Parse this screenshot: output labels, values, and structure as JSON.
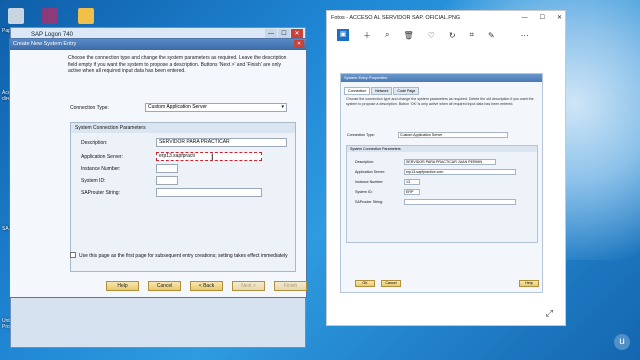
{
  "desktop": {
    "icons": [
      {
        "name": "papelera-icon",
        "label": "Papelera de...",
        "color": "#c8d4e0"
      },
      {
        "name": "winrar-icon",
        "label": "",
        "color": "#8b3a7a"
      },
      {
        "name": "folder-icon",
        "label": "",
        "color": "#f0c048"
      }
    ],
    "left_labels": [
      "Papelera de...",
      "Acces... directo",
      "SAP",
      "Untitled Project"
    ]
  },
  "logon": {
    "title": "SAP Logon 740"
  },
  "dialog": {
    "title": "Create New System Entry",
    "description": "Choose the connection type and change the system parameters as required. Leave the description field empty if you want the system to propose a description. Buttons 'Next >' and 'Finish' are only active when all required input data has been entered.",
    "connection_type_label": "Connection Type:",
    "connection_type_value": "Custom Application Server",
    "group_title": "System Connection Parameters",
    "fields": [
      {
        "label": "Description:",
        "value": ""
      },
      {
        "label": "Application Server:",
        "value": "erp13.sapfpracti"
      },
      {
        "label": "Instance Number:",
        "value": ""
      },
      {
        "label": "System ID:",
        "value": ""
      },
      {
        "label": "SAProuter String:",
        "value": ""
      }
    ],
    "description_value": "SERVIDOR PARA PRACTICAR",
    "checkbox_label": "Use this page as the first page for subsequent entry creations; setting takes effect immediately",
    "buttons": {
      "help": "Help",
      "cancel": "Cancel",
      "back": "< Back",
      "next": "Next >",
      "finish": "Finish"
    }
  },
  "fotos": {
    "title": "Fotos - ACCESO AL SERVIDOR SAP. OFICIAL.PNG",
    "controls": {
      "min": "—",
      "max": "☐",
      "close": "✕"
    },
    "toolbar": [
      "＋",
      "⌕",
      "🗑",
      "♡",
      "↻",
      "⌗",
      "✎"
    ],
    "more": "⋯",
    "screenshot": {
      "title": "System Entry Properties",
      "tabs": [
        "Connection",
        "Network",
        "Code Page"
      ],
      "description": "Choose the connection type and change the system parameters as required. Delete the old description if you want the system to propose a description. Button 'OK' is only active when all required input data has been entered.",
      "connection_type_label": "Connection Type:",
      "connection_type_value": "Custom Application Server",
      "group_title": "System Connection Parameters",
      "fields": [
        {
          "label": "Description:",
          "value": "SERVIDOR PARA PRACTICAR JUAN PERMIN"
        },
        {
          "label": "Application Server:",
          "value": "erp13.sapfpractice.com"
        },
        {
          "label": "Instance Number:",
          "value": "13"
        },
        {
          "label": "System ID:",
          "value": "ERP"
        },
        {
          "label": "SAProuter String:",
          "value": ""
        }
      ],
      "buttons": {
        "ok": "OK",
        "cancel": "Cancel",
        "help": "Help"
      }
    }
  }
}
